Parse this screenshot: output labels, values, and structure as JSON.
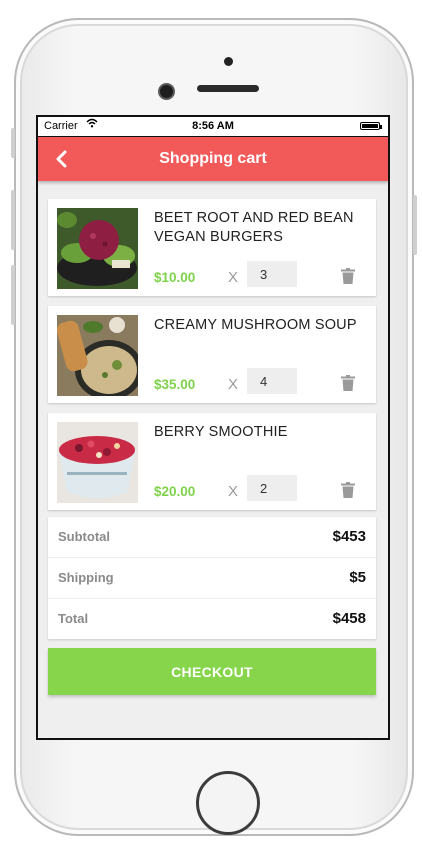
{
  "status_bar": {
    "carrier": "Carrier",
    "time": "8:56 AM",
    "wifi_icon": "wifi-icon",
    "battery_icon": "battery-icon"
  },
  "nav": {
    "title": "Shopping cart",
    "back_icon": "chevron-left-icon",
    "color": "#f25a5a"
  },
  "items": [
    {
      "name": "BEET ROOT AND RED BEAN VEGAN BURGERS",
      "price": "$10.00",
      "times": "X",
      "quantity": "3",
      "delete_icon": "trash-icon"
    },
    {
      "name": "CREAMY MUSHROOM SOUP",
      "price": "$35.00",
      "times": "X",
      "quantity": "4",
      "delete_icon": "trash-icon"
    },
    {
      "name": "BERRY SMOOTHIE",
      "price": "$20.00",
      "times": "X",
      "quantity": "2",
      "delete_icon": "trash-icon"
    }
  ],
  "summary": [
    {
      "label": "Subtotal",
      "value": "$453"
    },
    {
      "label": "Shipping",
      "value": "$5"
    },
    {
      "label": "Total",
      "value": "$458"
    }
  ],
  "checkout": {
    "label": "CHECKOUT",
    "color": "#86d54b"
  },
  "price_color": "#7ed24a"
}
